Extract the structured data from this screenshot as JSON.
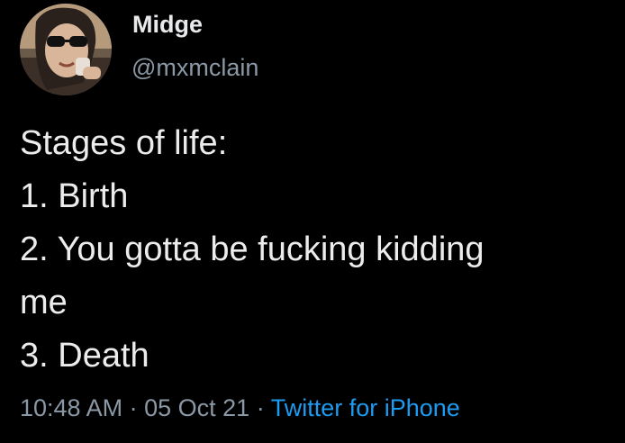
{
  "author": {
    "display_name": "Midge",
    "handle": "@mxmclain",
    "avatar_icon": "profile-photo"
  },
  "tweet": {
    "lines": [
      "Stages of life:",
      "1. Birth",
      "2. You gotta be fucking kidding",
      "me",
      "3. Death"
    ]
  },
  "meta": {
    "time": "10:48 AM",
    "separator": "·",
    "date": "05 Oct 21",
    "source": "Twitter for iPhone"
  },
  "colors": {
    "background": "#000000",
    "text": "#e7e9ea",
    "secondary": "#8b98a5",
    "link": "#1d9bf0"
  }
}
